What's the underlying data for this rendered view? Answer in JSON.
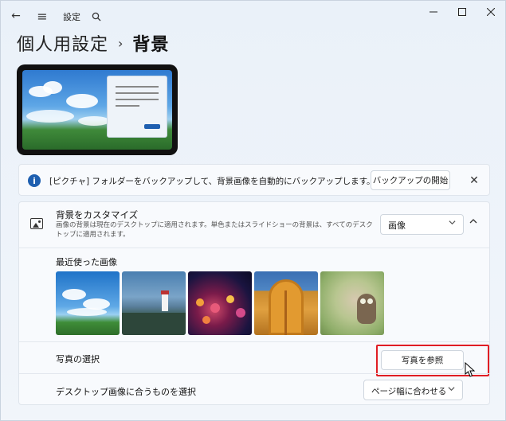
{
  "titlebar": {
    "title": "設定",
    "back_icon": "←",
    "menu_icon": "≡",
    "search_icon": "🔍",
    "minimize": "—",
    "maximize": "☐",
    "close": "✕"
  },
  "breadcrumb": {
    "parent": "個人用設定",
    "separator": "›",
    "current": "背景"
  },
  "notice": {
    "text": "[ピクチャ] フォルダーをバックアップして、背景画像を自動的にバックアップします。",
    "button": "バックアップの開始",
    "close": "✕"
  },
  "customize": {
    "title": "背景をカスタマイズ",
    "description": "画像の背景は現在のデスクトップに適用されます。単色またはスライドショーの背景は、すべてのデスクトップに適用されます。",
    "select_value": "画像",
    "chevron": "⌄",
    "collapse": "∧"
  },
  "recent": {
    "label": "最近使った画像",
    "images": [
      "青空と雲の風景",
      "灯台のある海岸",
      "ランタンの水面",
      "オレンジ色の扉",
      "フクロウ"
    ]
  },
  "choose_photo": {
    "label": "写真の選択",
    "button": "写真を参照"
  },
  "fit": {
    "label": "デスクトップ画像に合うものを選択",
    "value": "ページ幅に合わせる",
    "chevron": "⌄"
  }
}
